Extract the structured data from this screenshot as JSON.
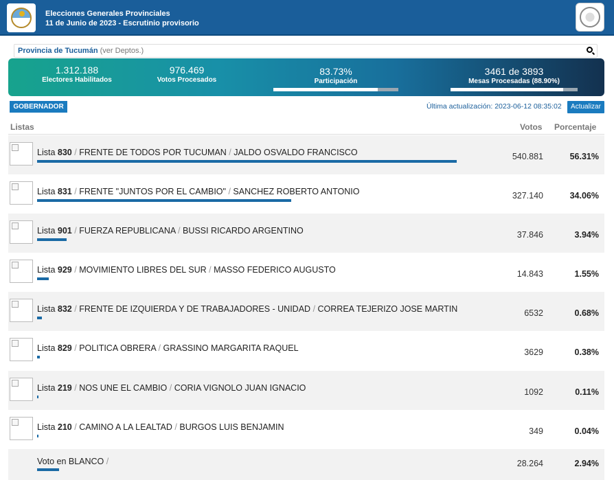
{
  "header": {
    "title_line1": "Elecciones Generales Provinciales",
    "title_line2": "11 de Junio de 2023 - Escrutinio provisorio"
  },
  "search": {
    "province": "Provincia de Tucumán",
    "sub": "(ver Deptos.)"
  },
  "stats": {
    "electores": {
      "value": "1.312.188",
      "label": "Electores Habilitados"
    },
    "votos": {
      "value": "976.469",
      "label": "Votos Procesados"
    },
    "participacion": {
      "value": "83.73%",
      "label": "Participación",
      "progress": 0.8373
    },
    "mesas": {
      "value": "3461 de 3893",
      "label": "Mesas Procesadas (88.90%)",
      "progress": 0.889
    }
  },
  "controls": {
    "tab": "GOBERNADOR",
    "updated": "Última actualización: 2023-06-12 08:35:02",
    "update_button": "Actualizar"
  },
  "table": {
    "col_listas": "Listas",
    "col_votos": "Votos",
    "col_pct": "Porcentaje",
    "rows": [
      {
        "lista": "Lista",
        "num": "830",
        "party": "FRENTE DE TODOS POR TUCUMAN",
        "candidate": "JALDO OSVALDO FRANCISCO",
        "votes": "540.881",
        "pct": "56.31%",
        "share": 56.31
      },
      {
        "lista": "Lista",
        "num": "831",
        "party": "FRENTE \"JUNTOS POR EL CAMBIO\"",
        "candidate": "SANCHEZ ROBERTO ANTONIO",
        "votes": "327.140",
        "pct": "34.06%",
        "share": 34.06
      },
      {
        "lista": "Lista",
        "num": "901",
        "party": "FUERZA REPUBLICANA",
        "candidate": "BUSSI RICARDO ARGENTINO",
        "votes": "37.846",
        "pct": "3.94%",
        "share": 3.94
      },
      {
        "lista": "Lista",
        "num": "929",
        "party": "MOVIMIENTO LIBRES DEL SUR",
        "candidate": "MASSO FEDERICO AUGUSTO",
        "votes": "14.843",
        "pct": "1.55%",
        "share": 1.55
      },
      {
        "lista": "Lista",
        "num": "832",
        "party": "FRENTE DE IZQUIERDA Y DE TRABAJADORES - UNIDAD",
        "candidate": "CORREA TEJERIZO JOSE MARTIN",
        "votes": "6532",
        "pct": "0.68%",
        "share": 0.68
      },
      {
        "lista": "Lista",
        "num": "829",
        "party": "POLITICA OBRERA",
        "candidate": "GRASSINO MARGARITA RAQUEL",
        "votes": "3629",
        "pct": "0.38%",
        "share": 0.38
      },
      {
        "lista": "Lista",
        "num": "219",
        "party": "NOS UNE EL CAMBIO",
        "candidate": "CORIA VIGNOLO JUAN IGNACIO",
        "votes": "1092",
        "pct": "0.11%",
        "share": 0.11
      },
      {
        "lista": "Lista",
        "num": "210",
        "party": "CAMINO A LA LEALTAD",
        "candidate": "BURGOS LUIS BENJAMIN",
        "votes": "349",
        "pct": "0.04%",
        "share": 0.04
      }
    ],
    "blank": {
      "label": "Voto en BLANCO",
      "sep": "/",
      "votes": "28.264",
      "pct": "2.94%",
      "share": 2.94
    }
  }
}
